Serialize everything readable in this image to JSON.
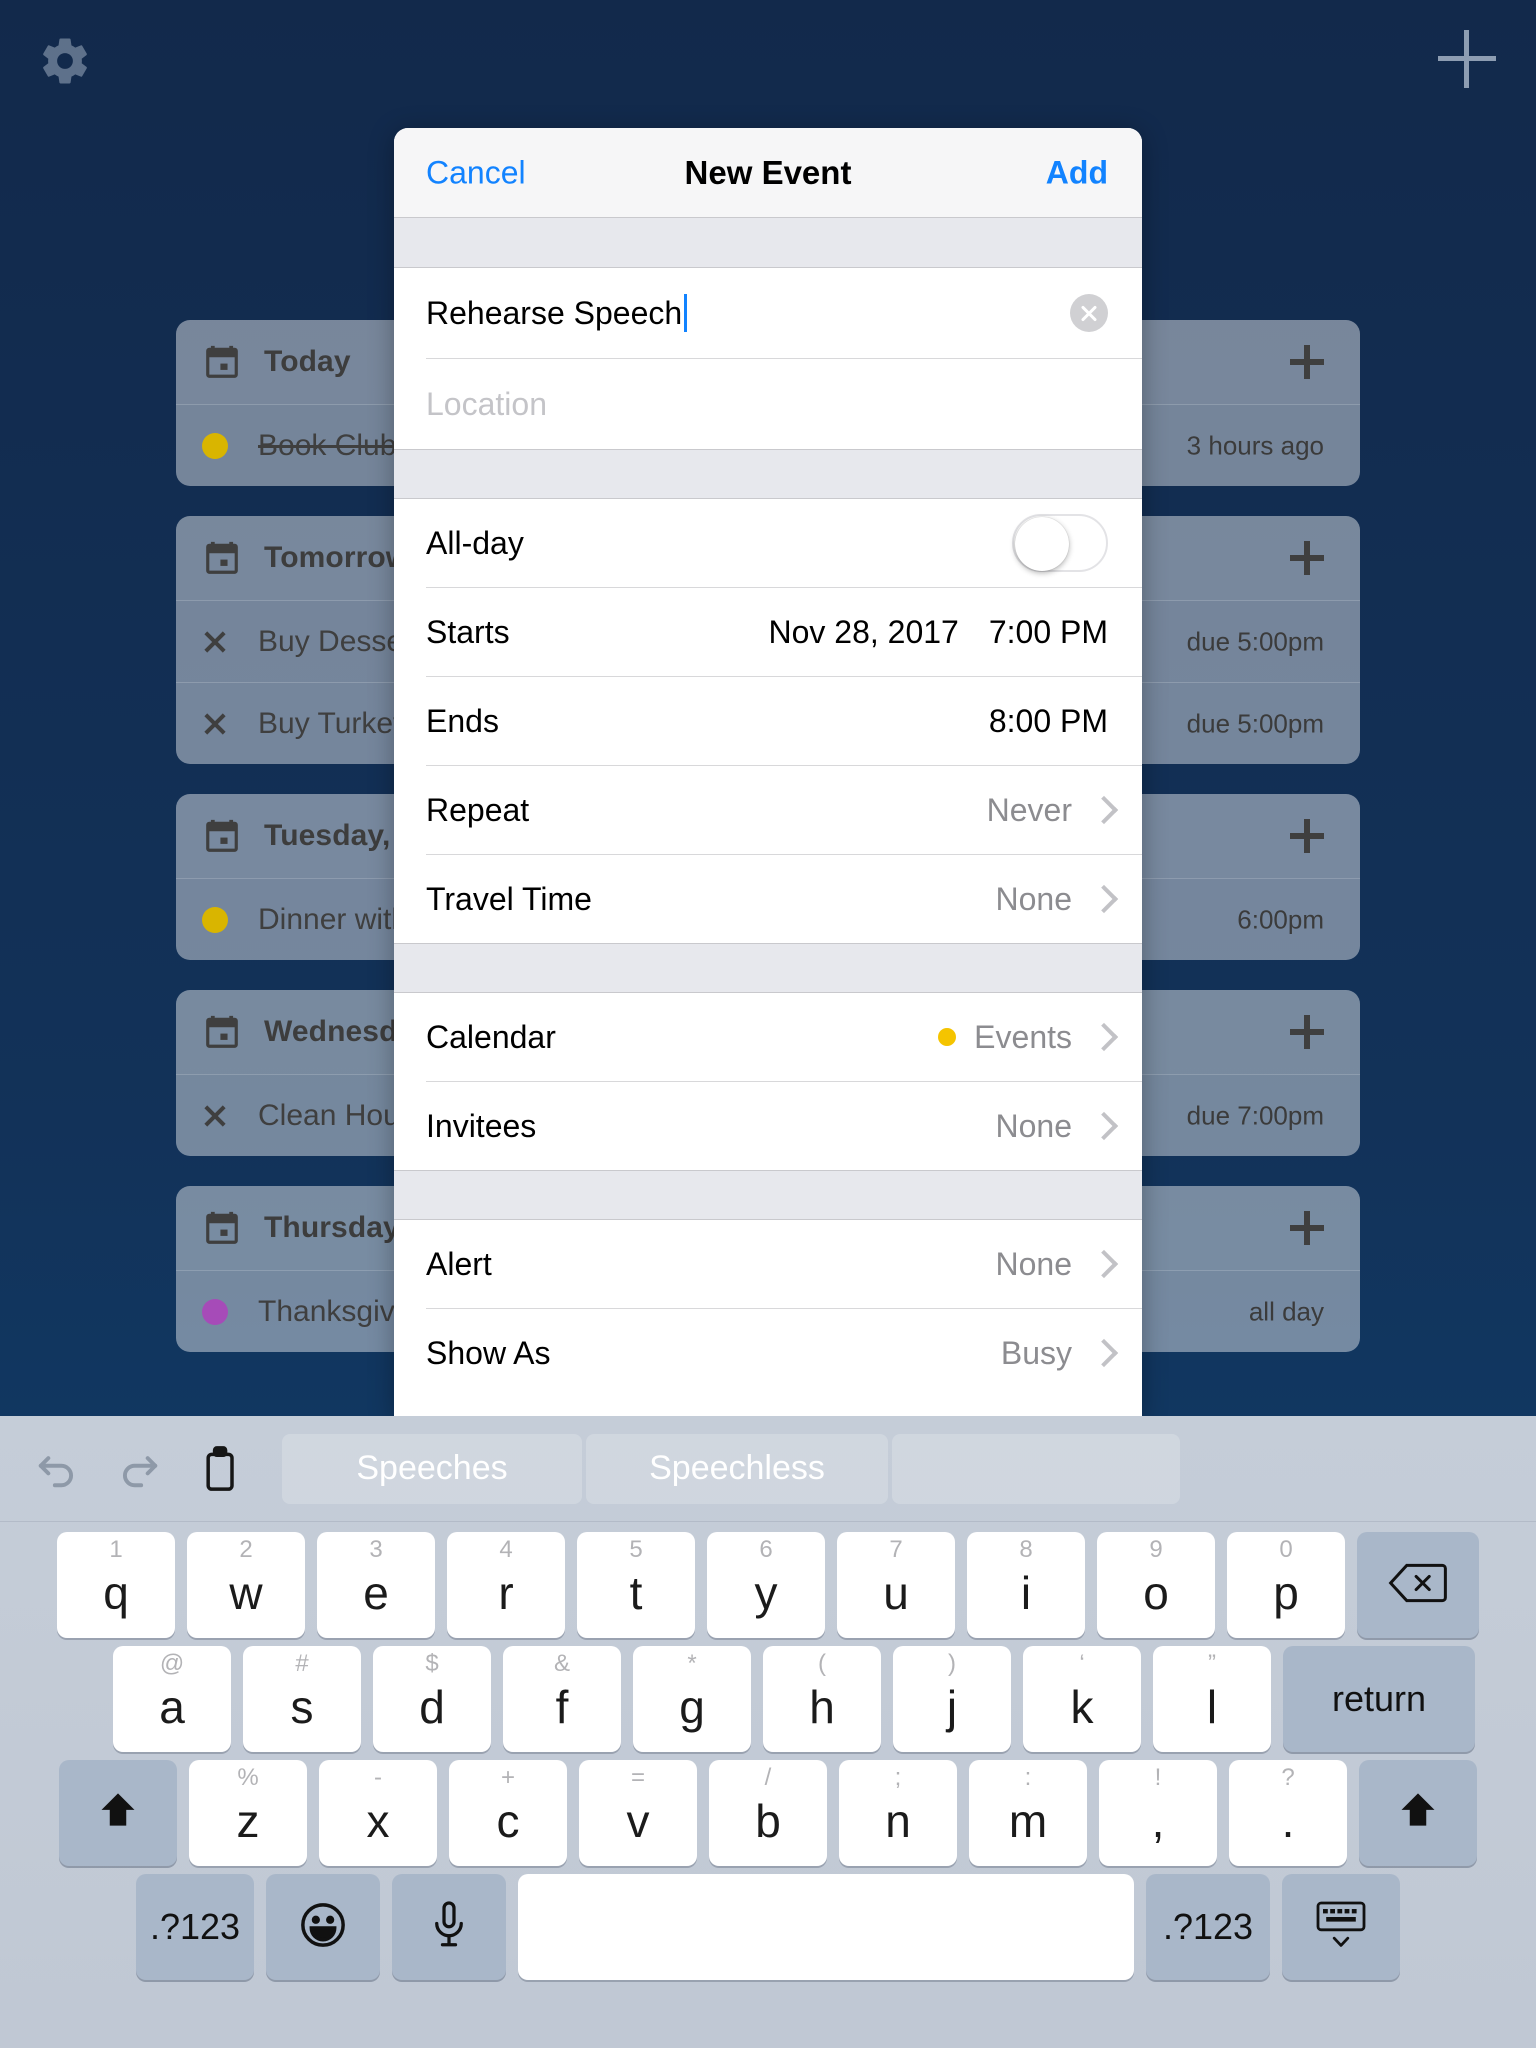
{
  "app": {
    "settings_icon": "gear-icon",
    "add_icon": "plus-icon",
    "background_color": "#123259"
  },
  "agenda": {
    "days": [
      {
        "title": "Today",
        "icon": "calendar-icon",
        "add_label": "+",
        "items": [
          {
            "marker": "dot",
            "dot_color": "#d9b500",
            "label": "Book Club",
            "completed": true,
            "meta": "3 hours ago"
          }
        ]
      },
      {
        "title": "Tomorrow",
        "icon": "calendar-icon",
        "add_label": "+",
        "items": [
          {
            "marker": "x",
            "label": "Buy Dessert",
            "completed": false,
            "meta": "due 5:00pm"
          },
          {
            "marker": "x",
            "label": "Buy Turkey",
            "completed": false,
            "meta": "due 5:00pm"
          }
        ]
      },
      {
        "title": "Tuesday,",
        "icon": "calendar-icon",
        "add_label": "+",
        "items": [
          {
            "marker": "dot",
            "dot_color": "#d9b500",
            "label": "Dinner with",
            "completed": false,
            "meta": "6:00pm"
          }
        ]
      },
      {
        "title": "Wednesday",
        "icon": "calendar-icon",
        "add_label": "+",
        "items": [
          {
            "marker": "x",
            "label": "Clean House",
            "completed": false,
            "meta": "due 7:00pm"
          }
        ]
      },
      {
        "title": "Thursday,",
        "icon": "calendar-icon",
        "add_label": "+",
        "items": [
          {
            "marker": "dot",
            "dot_color": "#a64bb8",
            "label": "Thanksgiving",
            "completed": false,
            "meta": "all day"
          }
        ]
      }
    ]
  },
  "modal": {
    "title": "New Event",
    "cancel_label": "Cancel",
    "add_label": "Add",
    "accent_color": "#1283ff",
    "title_field": {
      "value": "Rehearse Speech",
      "clear_icon": "clear-circle-icon"
    },
    "location_field": {
      "value": "",
      "placeholder": "Location"
    },
    "allday": {
      "label": "All-day",
      "on": false
    },
    "starts": {
      "label": "Starts",
      "date": "Nov 28, 2017",
      "time": "7:00 PM"
    },
    "ends": {
      "label": "Ends",
      "time": "8:00 PM"
    },
    "repeat": {
      "label": "Repeat",
      "value": "Never"
    },
    "travel_time": {
      "label": "Travel Time",
      "value": "None"
    },
    "calendar": {
      "label": "Calendar",
      "value": "Events",
      "dot_color": "#f5c400"
    },
    "invitees": {
      "label": "Invitees",
      "value": "None"
    },
    "alert": {
      "label": "Alert",
      "value": "None"
    },
    "show_as": {
      "label": "Show As",
      "value": "Busy"
    }
  },
  "keyboard": {
    "tools": [
      {
        "name": "undo-icon"
      },
      {
        "name": "redo-icon"
      },
      {
        "name": "paste-icon"
      }
    ],
    "suggestions": [
      "Speeches",
      "Speechless",
      ""
    ],
    "row1": [
      {
        "alt": "1",
        "main": "q"
      },
      {
        "alt": "2",
        "main": "w"
      },
      {
        "alt": "3",
        "main": "e"
      },
      {
        "alt": "4",
        "main": "r"
      },
      {
        "alt": "5",
        "main": "t"
      },
      {
        "alt": "6",
        "main": "y"
      },
      {
        "alt": "7",
        "main": "u"
      },
      {
        "alt": "8",
        "main": "i"
      },
      {
        "alt": "9",
        "main": "o"
      },
      {
        "alt": "0",
        "main": "p"
      }
    ],
    "backspace": "backspace-icon",
    "row2": [
      {
        "alt": "@",
        "main": "a"
      },
      {
        "alt": "#",
        "main": "s"
      },
      {
        "alt": "$",
        "main": "d"
      },
      {
        "alt": "&",
        "main": "f"
      },
      {
        "alt": "*",
        "main": "g"
      },
      {
        "alt": "(",
        "main": "h"
      },
      {
        "alt": ")",
        "main": "j"
      },
      {
        "alt": "‘",
        "main": "k"
      },
      {
        "alt": "”",
        "main": "l"
      }
    ],
    "return_label": "return",
    "row3": [
      {
        "alt": "%",
        "main": "z"
      },
      {
        "alt": "-",
        "main": "x"
      },
      {
        "alt": "+",
        "main": "c"
      },
      {
        "alt": "=",
        "main": "v"
      },
      {
        "alt": "/",
        "main": "b"
      },
      {
        "alt": ";",
        "main": "n"
      },
      {
        "alt": ":",
        "main": "m"
      },
      {
        "alt": "!",
        "main": ","
      },
      {
        "alt": "?",
        "main": "."
      }
    ],
    "shift_left": "shift-icon",
    "shift_right": "shift-icon",
    "row4": {
      "numbers_left": ".?123",
      "emoji": "emoji-icon",
      "mic": "microphone-icon",
      "space": "",
      "numbers_right": ".?123",
      "hide": "hide-keyboard-icon"
    }
  }
}
